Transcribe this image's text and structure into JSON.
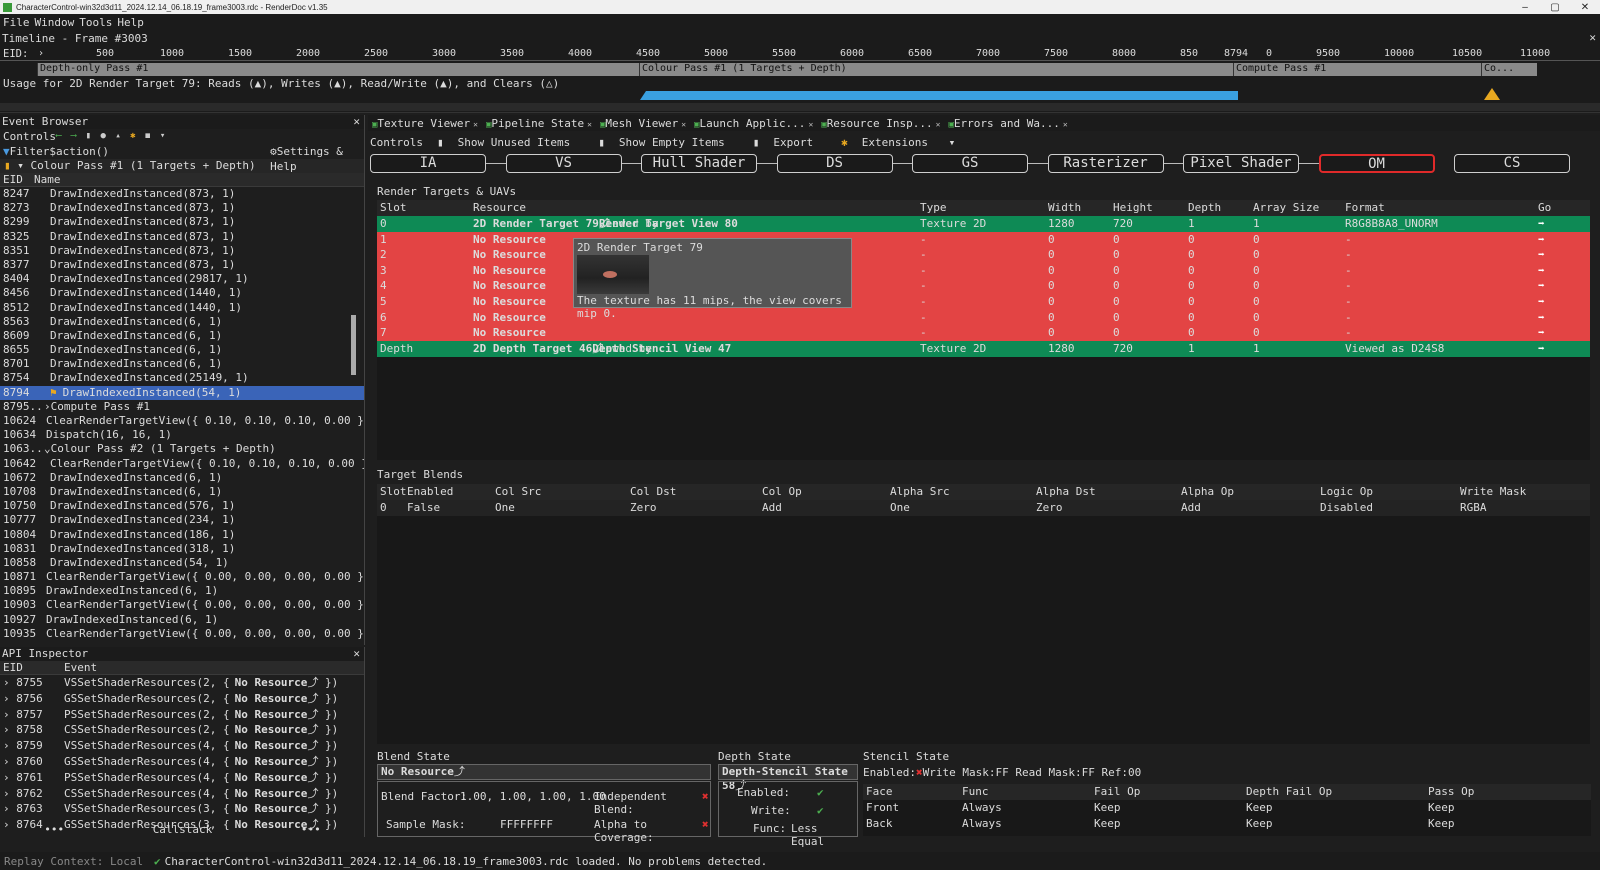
{
  "window": {
    "title": "CharacterControl-win32d3d11_2024.12.14_06.18.19_frame3003.rdc - RenderDoc v1.35",
    "controls": [
      "–",
      "▢",
      "✕"
    ]
  },
  "menu": [
    "File",
    "Window",
    "Tools",
    "Help"
  ],
  "timeline": {
    "title": "Timeline - Frame #3003",
    "eid_label": "EID:",
    "ticks": [
      "500",
      "1000",
      "1500",
      "2000",
      "2500",
      "3000",
      "3500",
      "4000",
      "4500",
      "5000",
      "5500",
      "6000",
      "6500",
      "7000",
      "7500",
      "8000",
      "850",
      "8794",
      "0",
      "9500",
      "10000",
      "10500",
      "11000"
    ],
    "passes": [
      "Depth-only Pass #1",
      "Colour Pass #1 (1 Targets + Depth)",
      "Compute Pass #1",
      "Co..."
    ],
    "usage": "Usage for 2D Render Target 79: Reads (▲), Writes (▲), Read/Write (▲), and Clears (△)"
  },
  "event_browser": {
    "title": "Event Browser",
    "controls_label": "Controls",
    "filter_label": "Filter",
    "filter_value": "$action()",
    "settings_label": "Settings & Help",
    "root": "Colour Pass #1 (1 Targets + Depth)",
    "col_eid": "EID",
    "col_name": "Name",
    "rows": [
      {
        "eid": "8247",
        "name": "DrawIndexedInstanced(873, 1)"
      },
      {
        "eid": "8273",
        "name": "DrawIndexedInstanced(873, 1)"
      },
      {
        "eid": "8299",
        "name": "DrawIndexedInstanced(873, 1)"
      },
      {
        "eid": "8325",
        "name": "DrawIndexedInstanced(873, 1)"
      },
      {
        "eid": "8351",
        "name": "DrawIndexedInstanced(873, 1)"
      },
      {
        "eid": "8377",
        "name": "DrawIndexedInstanced(873, 1)"
      },
      {
        "eid": "8404",
        "name": "DrawIndexedInstanced(29817, 1)"
      },
      {
        "eid": "8456",
        "name": "DrawIndexedInstanced(1440, 1)"
      },
      {
        "eid": "8512",
        "name": "DrawIndexedInstanced(1440, 1)"
      },
      {
        "eid": "8563",
        "name": "DrawIndexedInstanced(6, 1)"
      },
      {
        "eid": "8609",
        "name": "DrawIndexedInstanced(6, 1)"
      },
      {
        "eid": "8655",
        "name": "DrawIndexedInstanced(6, 1)"
      },
      {
        "eid": "8701",
        "name": "DrawIndexedInstanced(6, 1)"
      },
      {
        "eid": "8754",
        "name": "DrawIndexedInstanced(25149, 1)"
      },
      {
        "eid": "8794",
        "name": "DrawIndexedInstanced(54, 1)"
      },
      {
        "eid": "8795...",
        "name": "Compute Pass #1"
      },
      {
        "eid": "10624",
        "name": "ClearRenderTargetView({ 0.10, 0.10, 0.10, 0.00 })"
      },
      {
        "eid": "10634",
        "name": "Dispatch(16, 16, 1)"
      },
      {
        "eid": "1063...",
        "name": "Colour Pass #2 (1 Targets + Depth)"
      },
      {
        "eid": "10642",
        "name": "ClearRenderTargetView({ 0.10, 0.10, 0.10, 0.00 })"
      },
      {
        "eid": "10672",
        "name": "DrawIndexedInstanced(6, 1)"
      },
      {
        "eid": "10708",
        "name": "DrawIndexedInstanced(6, 1)"
      },
      {
        "eid": "10750",
        "name": "DrawIndexedInstanced(576, 1)"
      },
      {
        "eid": "10777",
        "name": "DrawIndexedInstanced(234, 1)"
      },
      {
        "eid": "10804",
        "name": "DrawIndexedInstanced(186, 1)"
      },
      {
        "eid": "10831",
        "name": "DrawIndexedInstanced(318, 1)"
      },
      {
        "eid": "10858",
        "name": "DrawIndexedInstanced(54, 1)"
      },
      {
        "eid": "10871",
        "name": "ClearRenderTargetView({ 0.00, 0.00, 0.00, 0.00 })"
      },
      {
        "eid": "10895",
        "name": "DrawIndexedInstanced(6, 1)"
      },
      {
        "eid": "10903",
        "name": "ClearRenderTargetView({ 0.00, 0.00, 0.00, 0.00 })"
      },
      {
        "eid": "10927",
        "name": "DrawIndexedInstanced(6, 1)"
      },
      {
        "eid": "10935",
        "name": "ClearRenderTargetView({ 0.00, 0.00, 0.00, 0.00 })"
      }
    ]
  },
  "api_inspector": {
    "title": "API Inspector",
    "col_eid": "EID",
    "col_event": "Event",
    "nores": "No Resource",
    "rows": [
      {
        "eid": "8755",
        "fn": "VSSetShaderResources(2, {"
      },
      {
        "eid": "8756",
        "fn": "GSSetShaderResources(2, {"
      },
      {
        "eid": "8757",
        "fn": "PSSetShaderResources(2, {"
      },
      {
        "eid": "8758",
        "fn": "CSSetShaderResources(2, {"
      },
      {
        "eid": "8759",
        "fn": "VSSetShaderResources(4, {"
      },
      {
        "eid": "8760",
        "fn": "GSSetShaderResources(4, {"
      },
      {
        "eid": "8761",
        "fn": "PSSetShaderResources(4, {"
      },
      {
        "eid": "8762",
        "fn": "CSSetShaderResources(4, {"
      },
      {
        "eid": "8763",
        "fn": "VSSetShaderResources(3, {"
      },
      {
        "eid": "8764",
        "fn": "GSSetShaderResources(3, {"
      }
    ],
    "footer_left": "•••",
    "footer_mid": "Callstack",
    "footer_right": "•••"
  },
  "tabs": [
    "Texture Viewer",
    "Pipeline State",
    "Mesh Viewer",
    "Launch Applic...",
    "Resource Insp...",
    "Errors and Wa..."
  ],
  "ps_controls": [
    "Controls",
    "Show Unused Items",
    "Show Empty Items",
    "Export",
    "Extensions"
  ],
  "stages": [
    "IA",
    "VS",
    "Hull Shader",
    "DS",
    "GS",
    "Rasterizer",
    "Pixel Shader",
    "OM",
    "CS"
  ],
  "render_targets": {
    "title": "Render Targets & UAVs",
    "headers": [
      "Slot",
      "Resource",
      "Type",
      "Width",
      "Height",
      "Depth",
      "Array Size",
      "Format",
      "Go"
    ],
    "rows": [
      {
        "slot": "0",
        "res": "2D Render Target 79",
        "view": " viewed by ",
        "view2": "Render Target View 80",
        "type": "Texture 2D",
        "w": "1280",
        "h": "720",
        "d": "1",
        "a": "1",
        "fmt": "R8G8B8A8_UNORM",
        "state": "green"
      },
      {
        "slot": "1",
        "res": "No Resource",
        "view": "",
        "view2": "",
        "type": "-",
        "w": "0",
        "h": "0",
        "d": "0",
        "a": "0",
        "fmt": "-",
        "state": "red"
      },
      {
        "slot": "2",
        "res": "No Resource",
        "view": "",
        "view2": "",
        "type": "-",
        "w": "0",
        "h": "0",
        "d": "0",
        "a": "0",
        "fmt": "-",
        "state": "red"
      },
      {
        "slot": "3",
        "res": "No Resource",
        "view": "",
        "view2": "",
        "type": "-",
        "w": "0",
        "h": "0",
        "d": "0",
        "a": "0",
        "fmt": "-",
        "state": "red"
      },
      {
        "slot": "4",
        "res": "No Resource",
        "view": "",
        "view2": "",
        "type": "-",
        "w": "0",
        "h": "0",
        "d": "0",
        "a": "0",
        "fmt": "-",
        "state": "red"
      },
      {
        "slot": "5",
        "res": "No Resource",
        "view": "",
        "view2": "",
        "type": "-",
        "w": "0",
        "h": "0",
        "d": "0",
        "a": "0",
        "fmt": "-",
        "state": "red"
      },
      {
        "slot": "6",
        "res": "No Resource",
        "view": "",
        "view2": "",
        "type": "-",
        "w": "0",
        "h": "0",
        "d": "0",
        "a": "0",
        "fmt": "-",
        "state": "red"
      },
      {
        "slot": "7",
        "res": "No Resource",
        "view": "",
        "view2": "",
        "type": "-",
        "w": "0",
        "h": "0",
        "d": "0",
        "a": "0",
        "fmt": "-",
        "state": "red"
      },
      {
        "slot": "Depth",
        "res": "2D Depth Target 46",
        "view": " viewed by ",
        "view2": "Depth Stencil View 47",
        "type": "Texture 2D",
        "w": "1280",
        "h": "720",
        "d": "1",
        "a": "1",
        "fmt": "Viewed as D24S8",
        "state": "green"
      }
    ]
  },
  "tooltip": {
    "title": "2D Render Target 79",
    "message": "The texture has 11 mips, the view covers mip 0."
  },
  "target_blends": {
    "title": "Target Blends",
    "headers": [
      "Slot",
      "Enabled",
      "Col Src",
      "Col Dst",
      "Col Op",
      "Alpha Src",
      "Alpha Dst",
      "Alpha Op",
      "Logic Op",
      "Write Mask"
    ],
    "row": [
      "0",
      "False",
      "One",
      "Zero",
      "Add",
      "One",
      "Zero",
      "Add",
      "Disabled",
      "RGBA"
    ]
  },
  "blend_state": {
    "title": "Blend State",
    "name": "No Resource",
    "blend_factor_label": "Blend Factor:",
    "blend_factor": "1.00, 1.00, 1.00, 1.00",
    "independent_label": "Independent Blend:",
    "sample_mask_label": "Sample Mask:",
    "sample_mask": "FFFFFFFF",
    "alpha_cov_label": "Alpha to Coverage:"
  },
  "depth_state": {
    "title": "Depth State",
    "name": "Depth-Stencil State 58",
    "enabled_label": "Enabled:",
    "write_label": "Write:",
    "func_label": "Func:",
    "func": "Less Equal"
  },
  "stencil_state": {
    "title": "Stencil State",
    "enabled_label": "Enabled:",
    "write_mask_label": "Write Mask:",
    "write_mask": "FF",
    "read_mask_label": "Read Mask:",
    "read_mask": "FF",
    "ref_label": "Ref:",
    "ref": "00",
    "headers": [
      "Face",
      "Func",
      "Fail Op",
      "Depth Fail Op",
      "Pass Op"
    ],
    "rows": [
      [
        "Front",
        "Always",
        "Keep",
        "Keep",
        "Keep"
      ],
      [
        "Back",
        "Always",
        "Keep",
        "Keep",
        "Keep"
      ]
    ]
  },
  "status": {
    "context": "Replay Context: Local",
    "message": "CharacterControl-win32d3d11_2024.12.14_06.18.19_frame3003.rdc loaded. No problems detected."
  }
}
